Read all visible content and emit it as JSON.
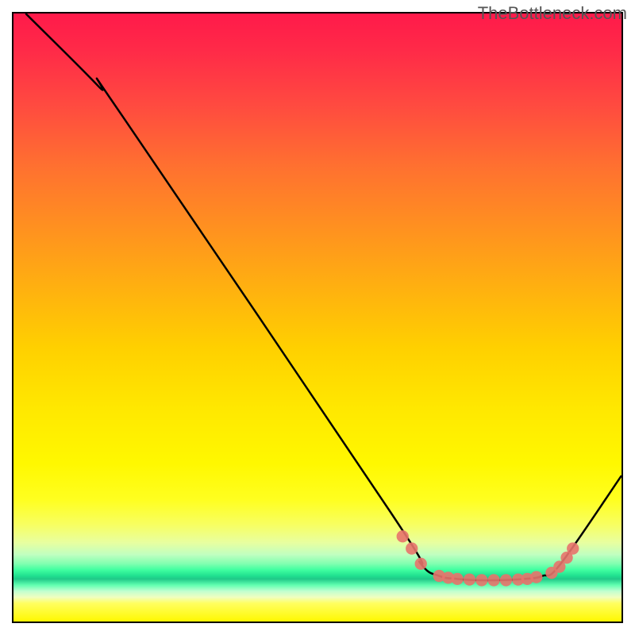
{
  "watermark": "TheBottleneck.com",
  "chart_data": {
    "type": "line",
    "title": "",
    "xlabel": "",
    "ylabel": "",
    "x_range": [
      0,
      100
    ],
    "y_range": [
      0,
      100
    ],
    "curve": [
      {
        "x": 2,
        "y": 100
      },
      {
        "x": 14,
        "y": 88
      },
      {
        "x": 18,
        "y": 83
      },
      {
        "x": 62,
        "y": 18
      },
      {
        "x": 67,
        "y": 9.5
      },
      {
        "x": 70,
        "y": 7.5
      },
      {
        "x": 73,
        "y": 7.0
      },
      {
        "x": 76,
        "y": 6.8
      },
      {
        "x": 80,
        "y": 6.8
      },
      {
        "x": 84,
        "y": 7.0
      },
      {
        "x": 87,
        "y": 7.5
      },
      {
        "x": 90,
        "y": 9.5
      },
      {
        "x": 100,
        "y": 24
      }
    ],
    "dots": [
      {
        "x": 64.0,
        "y": 14.0
      },
      {
        "x": 65.5,
        "y": 12.0
      },
      {
        "x": 67.0,
        "y": 9.5
      },
      {
        "x": 70.0,
        "y": 7.5
      },
      {
        "x": 71.5,
        "y": 7.2
      },
      {
        "x": 73.0,
        "y": 7.0
      },
      {
        "x": 75.0,
        "y": 6.9
      },
      {
        "x": 77.0,
        "y": 6.8
      },
      {
        "x": 79.0,
        "y": 6.8
      },
      {
        "x": 81.0,
        "y": 6.8
      },
      {
        "x": 83.0,
        "y": 6.9
      },
      {
        "x": 84.5,
        "y": 7.0
      },
      {
        "x": 86.0,
        "y": 7.3
      },
      {
        "x": 88.5,
        "y": 8.0
      },
      {
        "x": 89.8,
        "y": 9.0
      },
      {
        "x": 91.0,
        "y": 10.5
      },
      {
        "x": 92.0,
        "y": 12.0
      }
    ],
    "dot_color": "#e8736b",
    "dot_radius_pct": 1.0
  }
}
